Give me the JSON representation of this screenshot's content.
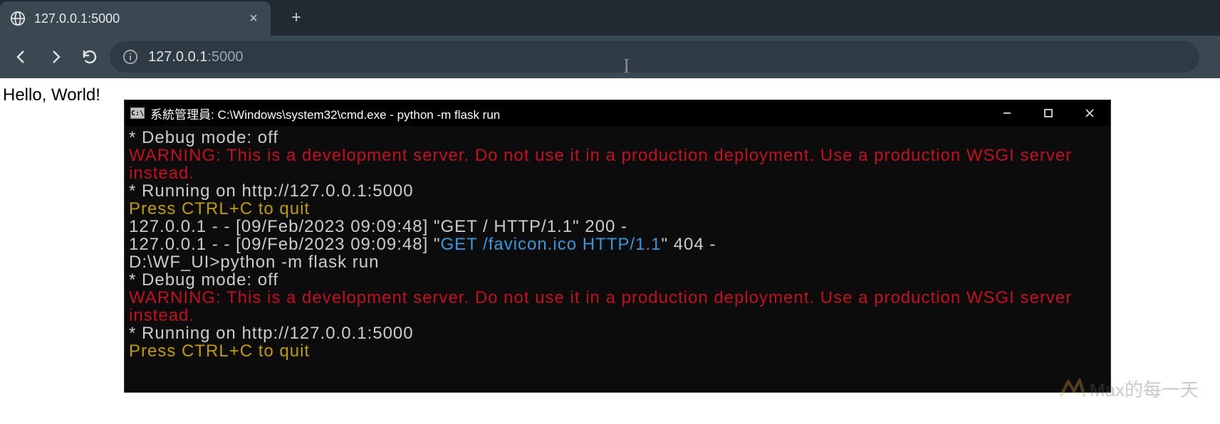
{
  "browser": {
    "tab": {
      "title": "127.0.0.1:5000"
    },
    "url_host": "127.0.0.1",
    "url_port": ":5000"
  },
  "page": {
    "body_text": "Hello, World!"
  },
  "cmd": {
    "title": "系統管理員: C:\\Windows\\system32\\cmd.exe - python  -m flask run",
    "lines": [
      {
        "cls": "c-white",
        "text": " * Debug mode: off"
      },
      {
        "cls": "c-red",
        "text": "WARNING: This is a development server. Do not use it in a production deployment. Use a production WSGI server instead."
      },
      {
        "cls": "c-white",
        "text": " * Running on http://127.0.0.1:5000"
      },
      {
        "cls": "c-yellow",
        "text": "Press CTRL+C to quit"
      }
    ],
    "log1_pre": "127.0.0.1 - - [09/Feb/2023 09:09:48] \"",
    "log1_mid": "GET / HTTP/1.1",
    "log1_post": "\" 200 -",
    "log2_pre": "127.0.0.1 - - [09/Feb/2023 09:09:48] \"",
    "log2_mid": "GET /favicon.ico HTTP/1.1",
    "log2_post": "\" 404 -",
    "blank": " ",
    "prompt": "D:\\WF_UI>python -m flask run",
    "lines2": [
      {
        "cls": "c-white",
        "text": " * Debug mode: off"
      },
      {
        "cls": "c-red",
        "text": "WARNING: This is a development server. Do not use it in a production deployment. Use a production WSGI server instead."
      },
      {
        "cls": "c-white",
        "text": " * Running on http://127.0.0.1:5000"
      },
      {
        "cls": "c-yellow",
        "text": "Press CTRL+C to quit"
      }
    ]
  },
  "watermark": {
    "text": "Max的每一天"
  }
}
